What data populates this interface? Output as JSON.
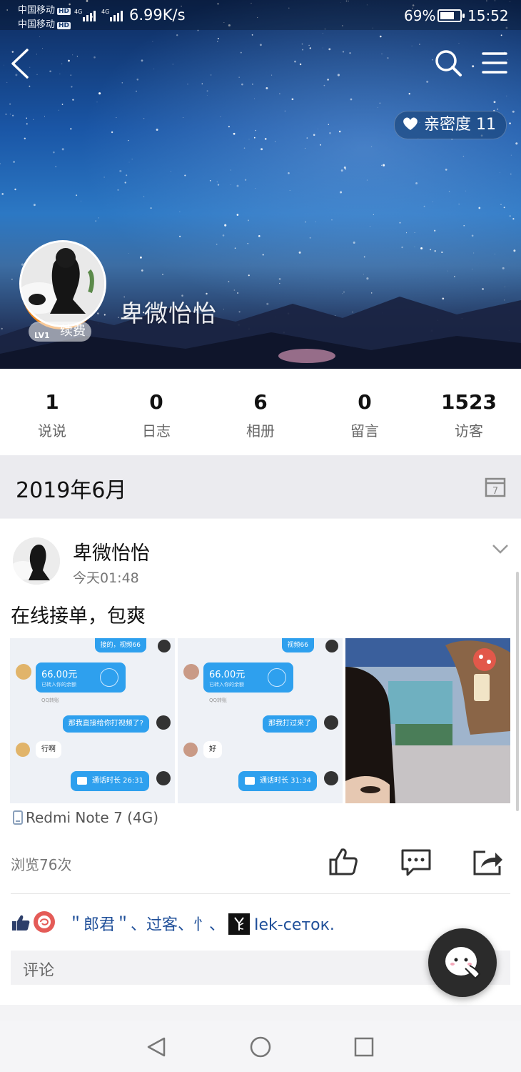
{
  "status_bar": {
    "carrier1": "中国移动",
    "carrier2": "中国移动",
    "hd": "HD",
    "net_speed": "6.99K/s",
    "battery": "69%",
    "time": "15:52"
  },
  "profile": {
    "intimacy_label": "亲密度",
    "intimacy_value": "11",
    "nickname": "卑微怡怡",
    "level": "LV1",
    "renew_label": "续费"
  },
  "stats": [
    {
      "value": "1",
      "label": "说说"
    },
    {
      "value": "0",
      "label": "日志"
    },
    {
      "value": "6",
      "label": "相册"
    },
    {
      "value": "0",
      "label": "留言"
    },
    {
      "value": "1523",
      "label": "访客"
    }
  ],
  "month": "2019年6月",
  "calendar_day": "7",
  "post": {
    "author": "卑微怡怡",
    "time": "今天01:48",
    "text": "在线接单，包爽",
    "images": [
      {
        "top": "接的，视频66",
        "amount": "66.00元",
        "sub": "已转入你的余额",
        "tag": "QQ转账",
        "ask": "那我直接给你打视频了?",
        "reply": "行啊",
        "call": "通话时长 26:31"
      },
      {
        "top": "视频66",
        "amount": "66.00元",
        "sub": "已转入你的余额",
        "tag": "QQ转账",
        "ask": "那我打过来了",
        "reply": "好",
        "call": "通话时长 31:34"
      }
    ],
    "device": "Redmi Note 7 (4G)",
    "views": "浏览76次",
    "likers": "＂郎君＂、过客、忄、",
    "likers_last": "Iek-сеток.",
    "comment_placeholder": "评论"
  },
  "icons": {
    "back": "back-arrow-icon",
    "search": "search-icon",
    "menu": "menu-icon",
    "calendar": "calendar-icon",
    "like": "thumbs-up-icon",
    "comment": "comment-icon",
    "share": "share-icon"
  },
  "colors": {
    "link": "#1f4f99",
    "level_ring": "#f28a1e",
    "fab": "#2b2b2b"
  }
}
